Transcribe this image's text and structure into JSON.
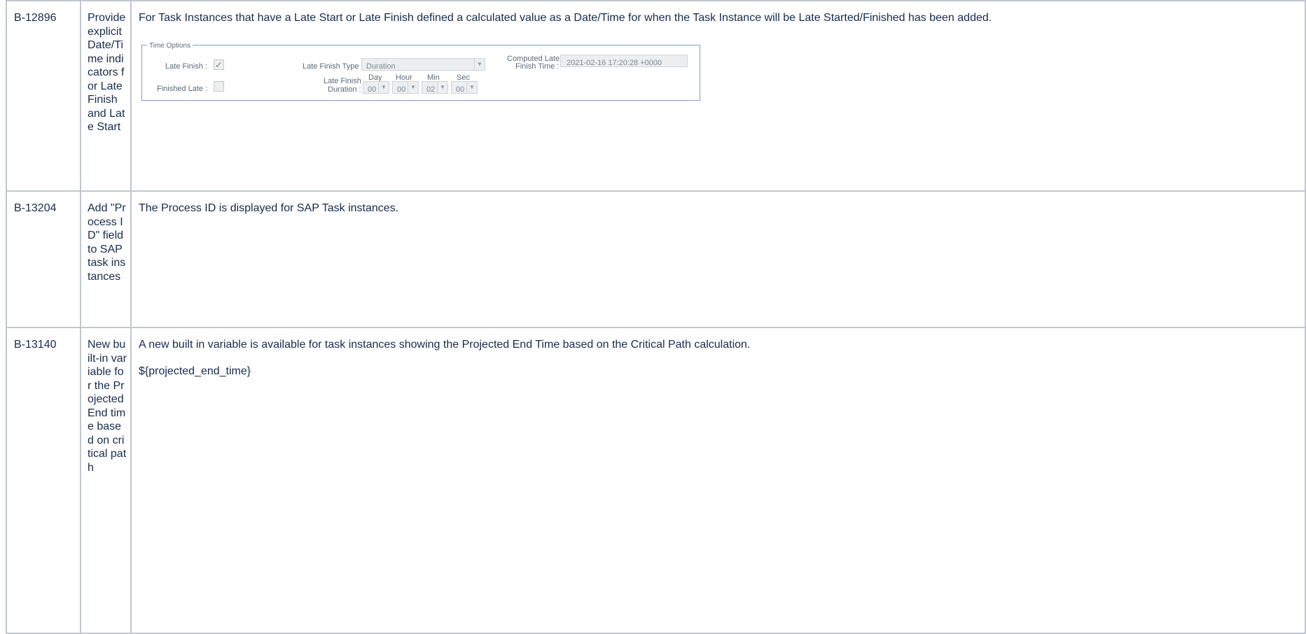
{
  "rows": [
    {
      "id": "B-12896",
      "summary": "Provide explicit Date/Time indicators for Late Finish and Late Start",
      "description": [
        "For Task Instances that have a Late Start or Late Finish defined a calculated value as a Date/Time for when the Task Instance will be Late Started/Finished has been added."
      ]
    },
    {
      "id": "B-13204",
      "summary": "Add \"Process ID\" field to SAP task instances",
      "description": [
        "The Process ID is displayed for SAP Task instances."
      ]
    },
    {
      "id": "B-13140",
      "summary": "New built-in variable for the Projected End time based on critical path",
      "description": [
        "A new built in variable is available for task instances showing the Projected End Time based on the Critical Path calculation.",
        "${projected_end_time}"
      ]
    }
  ],
  "time_options": {
    "legend": "Time Options",
    "late_finish_label": "Late Finish :",
    "late_finish_checked": true,
    "finished_late_label": "Finished Late :",
    "finished_late_checked": false,
    "late_finish_type_label": "Late Finish Type :",
    "late_finish_type_value": "Duration",
    "computed_label_line1": "Computed Late",
    "computed_label_line2": "Finish Time :",
    "computed_value": "2021-02-16 17:20:28 +0000",
    "duration_label_line1": "Late Finish",
    "duration_label_line2": "Duration :",
    "duration_units": [
      {
        "header": "Day",
        "value": "00"
      },
      {
        "header": "Hour",
        "value": "00"
      },
      {
        "header": "Min",
        "value": "02"
      },
      {
        "header": "Sec",
        "value": "00"
      }
    ]
  },
  "icons": {
    "check": "checkmark-icon",
    "dropdown": "chevron-down-icon"
  }
}
